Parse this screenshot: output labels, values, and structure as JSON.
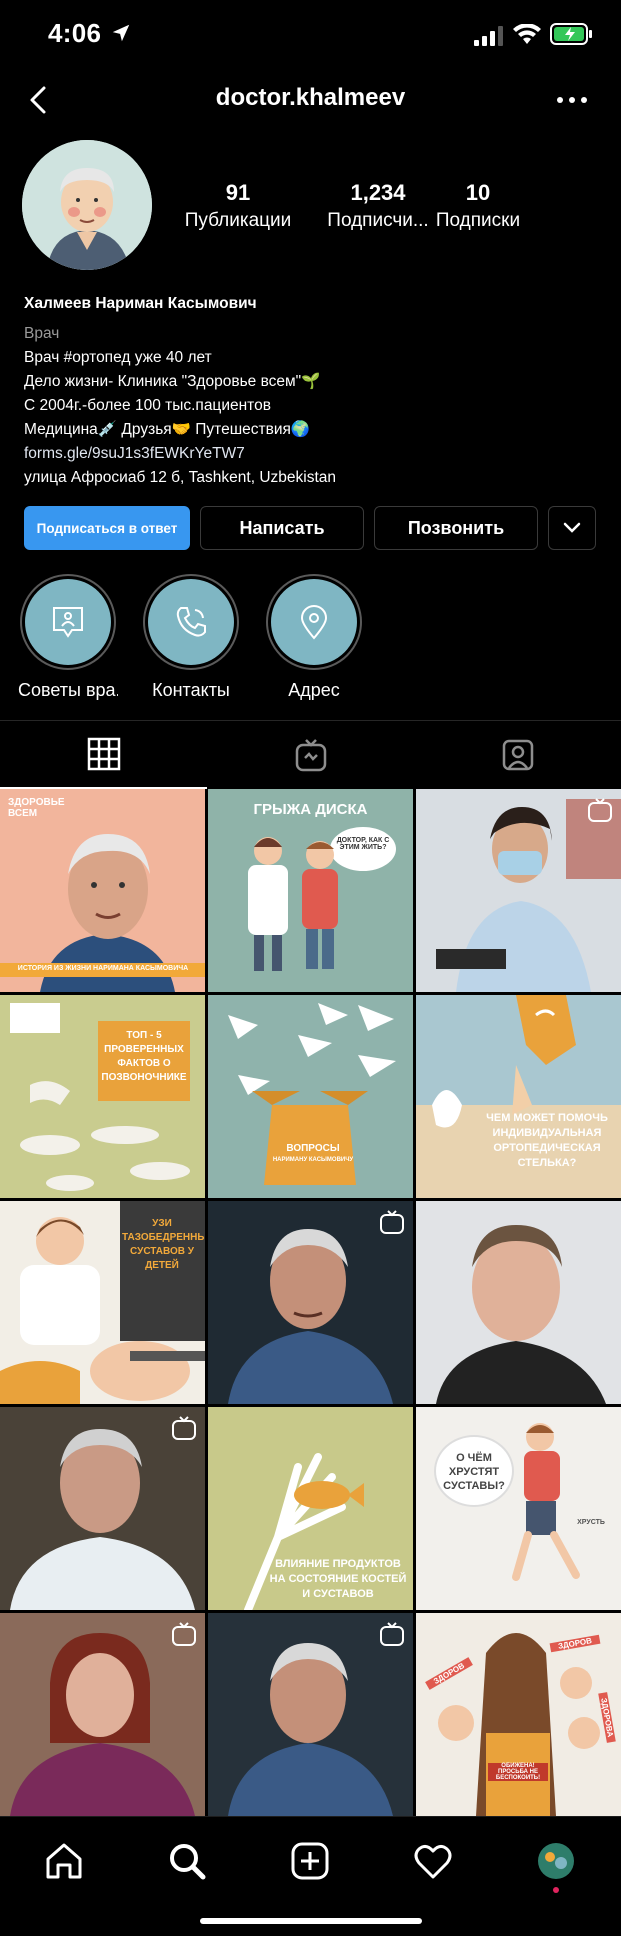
{
  "status": {
    "time": "4:06"
  },
  "header": {
    "username": "doctor.khalmeev"
  },
  "stats": {
    "posts": {
      "value": "91",
      "label": "Публикации"
    },
    "followers": {
      "value": "1,234",
      "label": "Подписчи..."
    },
    "following": {
      "value": "10",
      "label": "Подписки"
    }
  },
  "bio": {
    "name": "Халмеев Нариман Касымович",
    "category": "Врач",
    "lines": [
      "Врач #ортопед уже 40 лет",
      "Дело жизни- Клиника \"Здоровье всем\"🌱",
      "С 2004г.-более 100 тыс.пациентов",
      "Медицина💉 Друзья🤝 Путешествия🌍"
    ],
    "link": "forms.gle/9suJ1s3fEWKrYeTW7",
    "address": "улица Афросиаб 12 б, Tashkent, Uzbekistan"
  },
  "buttons": {
    "follow_back": "Подписаться в ответ",
    "message": "Написать",
    "call": "Позвонить"
  },
  "highlights": [
    {
      "label": "Советы вра...",
      "icon": "chat-doctor-icon"
    },
    {
      "label": "Контакты",
      "icon": "phone-icon"
    },
    {
      "label": "Адрес",
      "icon": "location-pin-icon"
    }
  ],
  "grid": {
    "captions": {
      "p1_brand": "ЗДОРОВЬЕ ВСЕМ",
      "p1_banner": "ИСТОРИЯ ИЗ ЖИЗНИ НАРИМАНА КАСЫМОВИЧА",
      "p2_title": "ГРЫЖА ДИСКА",
      "p2_bubble": "ДОКТОР, КАК С ЭТИМ ЖИТЬ?",
      "p4_title": "ТОП - 5 ПРОВЕРЕННЫХ ФАКТОВ О ПОЗВОНОЧНИКЕ",
      "p5_title": "ВОПРОСЫ",
      "p5_sub": "НАРИМАНУ КАСЫМОВИЧУ",
      "p6_title": "ЧЕМ МОЖЕТ ПОМОЧЬ ИНДИВИДУАЛЬНАЯ ОРТОПЕДИЧЕСКАЯ СТЕЛЬКА?",
      "p7_title": "УЗИ ТАЗОБЕДРЕННЫХ СУСТАВОВ У ДЕТЕЙ",
      "p11_title": "ВЛИЯНИЕ ПРОДУКТОВ НА СОСТОЯНИЕ КОСТЕЙ И СУСТАВОВ",
      "p12_title": "О ЧЁМ ХРУСТЯТ СУСТАВЫ?",
      "p12_sfx": "ХРУСТЬ",
      "p15_label1": "ЗДОРОВ",
      "p15_label2": "ЗДОРОВ",
      "p15_label3": "ЗДОРОВА",
      "p15_sign": "ОБИЖЕНА! ПРОСЬБА НЕ БЕСПОКОИТЬ!"
    }
  },
  "colors": {
    "accent": "#3897f0",
    "highlight_bg": "#7fb6c3",
    "background": "#000000"
  }
}
